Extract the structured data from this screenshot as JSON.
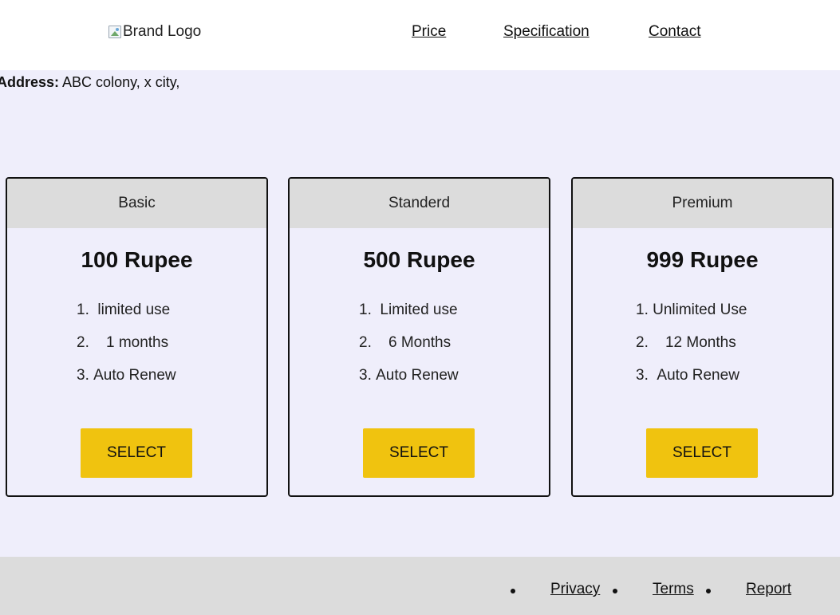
{
  "header": {
    "logo_alt": "Brand Logo",
    "nav": [
      "Price",
      "Specification",
      "Contact"
    ]
  },
  "address": {
    "label": "Address:",
    "value": "ABC colony, x city,"
  },
  "plans": [
    {
      "name": "Basic",
      "price": "100 Rupee",
      "features": [
        "limited use",
        "1 months",
        "Auto Renew"
      ],
      "button": "SELECT"
    },
    {
      "name": "Standerd",
      "price": "500 Rupee",
      "features": [
        "Limited use",
        "6 Months",
        "Auto Renew"
      ],
      "button": "SELECT"
    },
    {
      "name": "Premium",
      "price": "999 Rupee",
      "features": [
        "Unlimited Use",
        "12 Months",
        "Auto Renew"
      ],
      "button": "SELECT"
    }
  ],
  "footer": {
    "links": [
      "Privacy",
      "Terms",
      "Report"
    ]
  },
  "colors": {
    "page_bg": "#efeefb",
    "button": "#f0c30f",
    "card_header": "#dcdcdc",
    "footer_bg": "#dcdcdc"
  }
}
